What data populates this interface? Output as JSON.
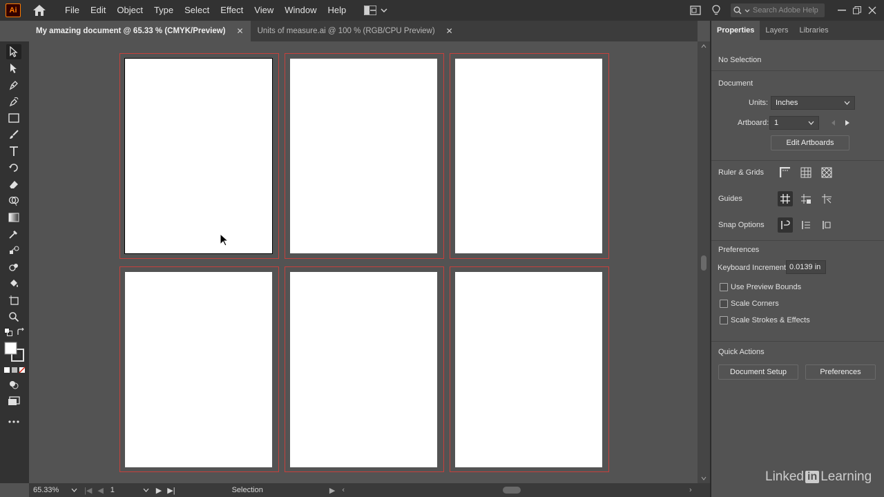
{
  "app": {
    "logo_text": "Ai",
    "menu": [
      "File",
      "Edit",
      "Object",
      "Type",
      "Select",
      "Effect",
      "View",
      "Window",
      "Help"
    ],
    "search_placeholder": "Search Adobe Help"
  },
  "tabs": [
    {
      "label": "My amazing document @ 65.33 % (CMYK/Preview)",
      "active": true
    },
    {
      "label": "Units of measure.ai @ 100 % (RGB/CPU Preview)",
      "active": false
    }
  ],
  "tools": [
    "selection-tool",
    "direct-selection-tool",
    "pen-tool",
    "curvature-tool",
    "rectangle-tool",
    "paintbrush-tool",
    "type-tool",
    "rotate-tool",
    "eraser-tool",
    "shape-builder-tool",
    "gradient-tool",
    "eyedropper-tool",
    "blend-tool",
    "symbol-sprayer-tool",
    "live-paint-tool",
    "artboard-tool",
    "zoom-tool"
  ],
  "statusbar": {
    "zoom": "65.33%",
    "artboard": "1",
    "tool": "Selection"
  },
  "panel": {
    "tabs": [
      "Properties",
      "Layers",
      "Libraries"
    ],
    "selection_state": "No Selection",
    "document_heading": "Document",
    "units_label": "Units:",
    "units_value": "Inches",
    "artboard_label": "Artboard:",
    "artboard_value": "1",
    "edit_artboards": "Edit Artboards",
    "ruler_grids": "Ruler & Grids",
    "guides": "Guides",
    "snap_options": "Snap Options",
    "preferences_heading": "Preferences",
    "keyboard_increment_label": "Keyboard Increment:",
    "keyboard_increment_value": "0.0139 in",
    "checkboxes": [
      "Use Preview Bounds",
      "Scale Corners",
      "Scale Strokes & Effects"
    ],
    "quick_actions": "Quick Actions",
    "document_setup": "Document Setup",
    "preferences_button": "Preferences"
  },
  "watermark": {
    "left": "Linked",
    "box": "in",
    "right": "Learning"
  },
  "colors": {
    "accent": "#ff7c00",
    "bleed": "#c8403c",
    "artboard": "#ffffff"
  }
}
